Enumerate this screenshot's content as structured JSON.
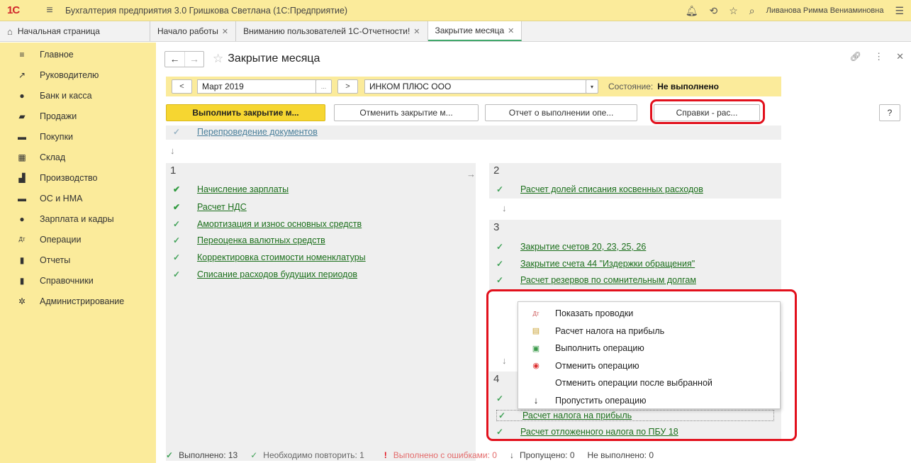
{
  "titlebar": {
    "logo": "1С",
    "app_title": "Бухгалтерия предприятия 3.0 Гришкова Светлана  (1С:Предприятие)",
    "user": "Ливанова Римма Вениаминовна"
  },
  "tabs": {
    "home": "Начальная страница",
    "items": [
      {
        "label": "Начало работы"
      },
      {
        "label": "Вниманию пользователей 1С-Отчетности!"
      },
      {
        "label": "Закрытие месяца"
      }
    ]
  },
  "sidebar": {
    "items": [
      {
        "label": "Главное",
        "icon": "menu-icon"
      },
      {
        "label": "Руководителю",
        "icon": "chart-line-icon"
      },
      {
        "label": "Банк и касса",
        "icon": "coin-icon"
      },
      {
        "label": "Продажи",
        "icon": "bag-icon"
      },
      {
        "label": "Покупки",
        "icon": "cart-icon"
      },
      {
        "label": "Склад",
        "icon": "warehouse-icon"
      },
      {
        "label": "Производство",
        "icon": "factory-icon"
      },
      {
        "label": "ОС и НМА",
        "icon": "truck-icon"
      },
      {
        "label": "Зарплата и кадры",
        "icon": "person-icon"
      },
      {
        "label": "Операции",
        "icon": "dt-kt-icon"
      },
      {
        "label": "Отчеты",
        "icon": "bar-chart-icon"
      },
      {
        "label": "Справочники",
        "icon": "book-icon"
      },
      {
        "label": "Администрирование",
        "icon": "gear-icon"
      }
    ]
  },
  "page": {
    "title": "Закрытие месяца"
  },
  "filter": {
    "prev": "<",
    "period": "Март 2019",
    "period_btn": "...",
    "next": ">",
    "org": "ИНКОМ ПЛЮС ООО",
    "state_label": "Состояние:",
    "state_value": "Не выполнено"
  },
  "actions": {
    "run": "Выполнить закрытие м...",
    "cancel": "Отменить закрытие м...",
    "report": "Отчет о выполнении опе...",
    "refs": "Справки - рас...",
    "help": "?"
  },
  "repost": "Перепроведение документов",
  "block1": {
    "num": "1",
    "ops": [
      "Начисление зарплаты",
      "Расчет НДС",
      "Амортизация и износ основных средств",
      "Переоценка валютных средств",
      "Корректировка стоимости номенклатуры",
      "Списание расходов будущих периодов"
    ]
  },
  "block2": {
    "num": "2",
    "ops": [
      "Расчет долей списания косвенных расходов"
    ]
  },
  "block3": {
    "num": "3",
    "ops": [
      "Закрытие счетов 20, 23, 25, 26",
      "Закрытие счета 44 \"Издержки обращения\"",
      "Расчет резервов по сомнительным долгам"
    ]
  },
  "block4": {
    "num": "4",
    "ops": [
      "Расчет налога на прибыль",
      "Расчет отложенного налога по ПБУ 18"
    ]
  },
  "context_menu": {
    "items": [
      {
        "label": "Показать проводки",
        "icon": "dt-kt-icon"
      },
      {
        "label": "Расчет налога на прибыль",
        "icon": "report-icon"
      },
      {
        "label": "Выполнить операцию",
        "icon": "run-icon"
      },
      {
        "label": "Отменить операцию",
        "icon": "cancel-icon"
      },
      {
        "label": "Отменить операции после выбранной",
        "icon": ""
      },
      {
        "label": "Пропустить операцию",
        "icon": "skip-arrow-icon"
      }
    ]
  },
  "footer": {
    "done": "Выполнено: 13",
    "repeat": "Необходимо повторить: 1",
    "errors": "Выполнено с ошибками: 0",
    "skipped": "Пропущено: 0",
    "not_done": "Не выполнено: 0"
  },
  "colors": {
    "sidebar_bg": "#fbeb9b",
    "primary_button": "#f6d631",
    "highlight_border": "#e2101c",
    "link_green": "#1b6f1b"
  }
}
